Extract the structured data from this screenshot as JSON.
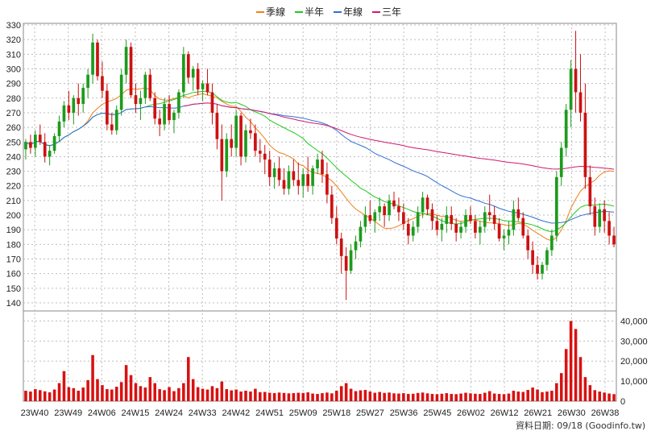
{
  "chart_data": {
    "type": "candlestick",
    "legend": [
      {
        "name": "季線",
        "color": "#f07f1a"
      },
      {
        "name": "半年",
        "color": "#1ec81e"
      },
      {
        "name": "年線",
        "color": "#2f6fd6"
      },
      {
        "name": "三年",
        "color": "#d01a6e"
      }
    ],
    "price_axis": {
      "ylim": [
        140,
        330
      ],
      "ticks": [
        330,
        320,
        310,
        300,
        290,
        280,
        270,
        260,
        250,
        240,
        230,
        220,
        210,
        200,
        190,
        180,
        170,
        160,
        150,
        140
      ]
    },
    "volume_axis": {
      "ylim": [
        0,
        45000
      ],
      "ticks": [
        "40,000",
        "30,000",
        "20,000",
        "10,000",
        "0"
      ],
      "tick_values": [
        40000,
        30000,
        20000,
        10000,
        0
      ]
    },
    "x_ticks": [
      "23W40",
      "23W49",
      "24W06",
      "24W15",
      "24W24",
      "24W33",
      "24W42",
      "24W51",
      "25W09",
      "25W18",
      "25W27",
      "25W36",
      "25W45",
      "26W02",
      "26W12",
      "26W21",
      "26W30",
      "26W38"
    ],
    "footer": "資料日期: 09/18  (Goodinfo.tw)",
    "up_color": "#1c9b1c",
    "down_color": "#cc1111",
    "candles": [
      [
        245,
        252,
        238,
        250
      ],
      [
        250,
        255,
        242,
        246
      ],
      [
        246,
        258,
        240,
        255
      ],
      [
        255,
        262,
        248,
        250
      ],
      [
        250,
        256,
        236,
        240
      ],
      [
        240,
        248,
        234,
        244
      ],
      [
        244,
        256,
        242,
        254
      ],
      [
        254,
        268,
        250,
        264
      ],
      [
        264,
        278,
        260,
        275
      ],
      [
        275,
        285,
        265,
        270
      ],
      [
        270,
        282,
        262,
        280
      ],
      [
        280,
        290,
        268,
        276
      ],
      [
        276,
        290,
        270,
        287
      ],
      [
        287,
        300,
        280,
        296
      ],
      [
        296,
        324,
        290,
        318
      ],
      [
        318,
        320,
        292,
        295
      ],
      [
        295,
        305,
        280,
        285
      ],
      [
        285,
        290,
        258,
        262
      ],
      [
        262,
        270,
        255,
        258
      ],
      [
        258,
        275,
        255,
        272
      ],
      [
        272,
        300,
        268,
        296
      ],
      [
        296,
        320,
        290,
        315
      ],
      [
        315,
        318,
        280,
        282
      ],
      [
        282,
        290,
        270,
        276
      ],
      [
        276,
        285,
        265,
        280
      ],
      [
        280,
        298,
        276,
        296
      ],
      [
        296,
        300,
        278,
        280
      ],
      [
        280,
        284,
        262,
        266
      ],
      [
        266,
        272,
        254,
        262
      ],
      [
        262,
        280,
        258,
        276
      ],
      [
        276,
        282,
        262,
        265
      ],
      [
        265,
        272,
        256,
        270
      ],
      [
        270,
        286,
        266,
        284
      ],
      [
        284,
        315,
        280,
        310
      ],
      [
        310,
        312,
        290,
        294
      ],
      [
        294,
        302,
        285,
        300
      ],
      [
        300,
        304,
        282,
        286
      ],
      [
        286,
        292,
        278,
        290
      ],
      [
        290,
        300,
        282,
        284
      ],
      [
        284,
        290,
        262,
        270
      ],
      [
        270,
        276,
        245,
        252
      ],
      [
        252,
        262,
        210,
        230
      ],
      [
        230,
        256,
        226,
        252
      ],
      [
        252,
        262,
        240,
        246
      ],
      [
        246,
        272,
        240,
        268
      ],
      [
        268,
        270,
        234,
        240
      ],
      [
        240,
        262,
        236,
        258
      ],
      [
        258,
        266,
        252,
        256
      ],
      [
        256,
        262,
        240,
        244
      ],
      [
        244,
        252,
        236,
        242
      ],
      [
        242,
        248,
        228,
        238
      ],
      [
        238,
        244,
        220,
        226
      ],
      [
        226,
        236,
        218,
        232
      ],
      [
        232,
        240,
        220,
        224
      ],
      [
        224,
        232,
        214,
        218
      ],
      [
        218,
        234,
        214,
        230
      ],
      [
        230,
        238,
        220,
        224
      ],
      [
        224,
        236,
        214,
        220
      ],
      [
        220,
        232,
        212,
        228
      ],
      [
        228,
        240,
        216,
        220
      ],
      [
        220,
        234,
        214,
        232
      ],
      [
        232,
        242,
        228,
        238
      ],
      [
        238,
        244,
        222,
        228
      ],
      [
        228,
        236,
        208,
        214
      ],
      [
        214,
        220,
        194,
        198
      ],
      [
        198,
        206,
        180,
        184
      ],
      [
        184,
        188,
        160,
        172
      ],
      [
        172,
        178,
        142,
        162
      ],
      [
        162,
        180,
        160,
        176
      ],
      [
        176,
        186,
        170,
        182
      ],
      [
        182,
        196,
        178,
        192
      ],
      [
        192,
        206,
        188,
        200
      ],
      [
        200,
        210,
        194,
        196
      ],
      [
        196,
        204,
        188,
        202
      ],
      [
        202,
        212,
        196,
        206
      ],
      [
        206,
        208,
        192,
        200
      ],
      [
        200,
        214,
        196,
        210
      ],
      [
        210,
        216,
        204,
        206
      ],
      [
        206,
        212,
        196,
        202
      ],
      [
        202,
        208,
        190,
        194
      ],
      [
        194,
        198,
        180,
        186
      ],
      [
        186,
        196,
        182,
        192
      ],
      [
        192,
        206,
        188,
        202
      ],
      [
        202,
        216,
        198,
        212
      ],
      [
        212,
        214,
        200,
        204
      ],
      [
        204,
        208,
        190,
        196
      ],
      [
        196,
        200,
        186,
        190
      ],
      [
        190,
        198,
        182,
        194
      ],
      [
        194,
        206,
        188,
        200
      ],
      [
        200,
        206,
        190,
        194
      ],
      [
        194,
        198,
        182,
        188
      ],
      [
        188,
        196,
        184,
        192
      ],
      [
        192,
        204,
        188,
        200
      ],
      [
        200,
        206,
        194,
        196
      ],
      [
        196,
        200,
        184,
        188
      ],
      [
        188,
        196,
        180,
        192
      ],
      [
        192,
        206,
        188,
        202
      ],
      [
        202,
        214,
        196,
        200
      ],
      [
        200,
        206,
        190,
        194
      ],
      [
        194,
        198,
        182,
        184
      ],
      [
        184,
        190,
        176,
        186
      ],
      [
        186,
        196,
        180,
        190
      ],
      [
        190,
        210,
        186,
        204
      ],
      [
        204,
        212,
        196,
        198
      ],
      [
        198,
        202,
        184,
        186
      ],
      [
        186,
        190,
        170,
        176
      ],
      [
        176,
        182,
        160,
        166
      ],
      [
        166,
        172,
        156,
        160
      ],
      [
        160,
        168,
        156,
        166
      ],
      [
        166,
        178,
        162,
        176
      ],
      [
        176,
        190,
        172,
        186
      ],
      [
        186,
        230,
        182,
        226
      ],
      [
        226,
        250,
        220,
        246
      ],
      [
        246,
        276,
        240,
        272
      ],
      [
        272,
        306,
        260,
        300
      ],
      [
        300,
        326,
        270,
        284
      ],
      [
        284,
        310,
        264,
        270
      ],
      [
        270,
        290,
        218,
        226
      ],
      [
        226,
        234,
        200,
        206
      ],
      [
        206,
        212,
        186,
        192
      ],
      [
        192,
        208,
        188,
        204
      ],
      [
        204,
        210,
        188,
        196
      ],
      [
        196,
        202,
        180,
        186
      ],
      [
        186,
        192,
        178,
        180
      ]
    ],
    "volume": [
      5200,
      4800,
      6000,
      5500,
      4900,
      4400,
      5800,
      9000,
      15000,
      7000,
      6500,
      5200,
      6800,
      10500,
      23000,
      11000,
      8000,
      6000,
      5800,
      7200,
      9500,
      18000,
      13000,
      9000,
      7500,
      6800,
      12000,
      9000,
      6000,
      5500,
      7000,
      5000,
      6500,
      9000,
      22000,
      11000,
      7000,
      6200,
      5800,
      7500,
      6500,
      9800,
      6000,
      5400,
      5800,
      4800,
      5200,
      4800,
      6200,
      4500,
      4600,
      4200,
      4000,
      4300,
      4100,
      3900,
      4000,
      4200,
      4100,
      4400,
      3800,
      3600,
      4000,
      4300,
      3900,
      5200,
      7500,
      9000,
      6200,
      5000,
      5400,
      5600,
      4800,
      4200,
      4600,
      4100,
      4300,
      3900,
      3800,
      4000,
      3600,
      3700,
      4100,
      4300,
      3900,
      3600,
      3500,
      3700,
      4000,
      3600,
      3500,
      3800,
      4200,
      3900,
      3700,
      3600,
      4200,
      5000,
      3800,
      3600,
      3500,
      3800,
      5200,
      4800,
      4600,
      5600,
      6800,
      5800,
      4500,
      4800,
      5200,
      9000,
      14000,
      26000,
      40000,
      36000,
      22000,
      12000,
      8000,
      5500,
      4800,
      4300,
      3800,
      3500
    ]
  }
}
